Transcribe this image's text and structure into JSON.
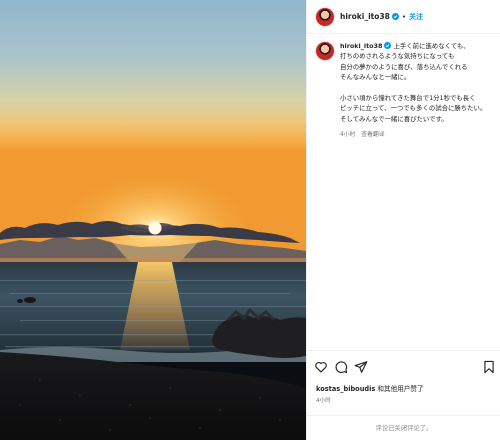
{
  "header": {
    "username": "hiroki_ito38",
    "follow_label": "关注",
    "separator": "•"
  },
  "caption": {
    "username": "hiroki_ito38",
    "lines_part1": [
      "上手く前に進めなくても、",
      "打ちのめされるような気持ちになっても",
      "自分の夢かのように喜び、落ち込んでくれる",
      "そんなみんなと一緒に。"
    ],
    "lines_part2": [
      "小さい頃から憧れてきた舞台で1分1秒でも長く",
      "ピッチに立って、一つでも多くの試合に勝ちたい。",
      "そしてみんなで一緒に喜びたいです。"
    ],
    "time": "4小时",
    "translate_label": "查看翻译"
  },
  "actions": {
    "icons": [
      "heart-icon",
      "comment-icon",
      "share-icon",
      "bookmark-icon"
    ],
    "liked_by_user": "kostas_biboudis",
    "liked_by_rest": " 和其他用户赞了",
    "time": "4小时",
    "comments_disabled": "评论已关闭评论了。"
  },
  "colors": {
    "link_blue": "#0095f6",
    "muted": "#737373",
    "text": "#262626",
    "border": "#efefef"
  }
}
